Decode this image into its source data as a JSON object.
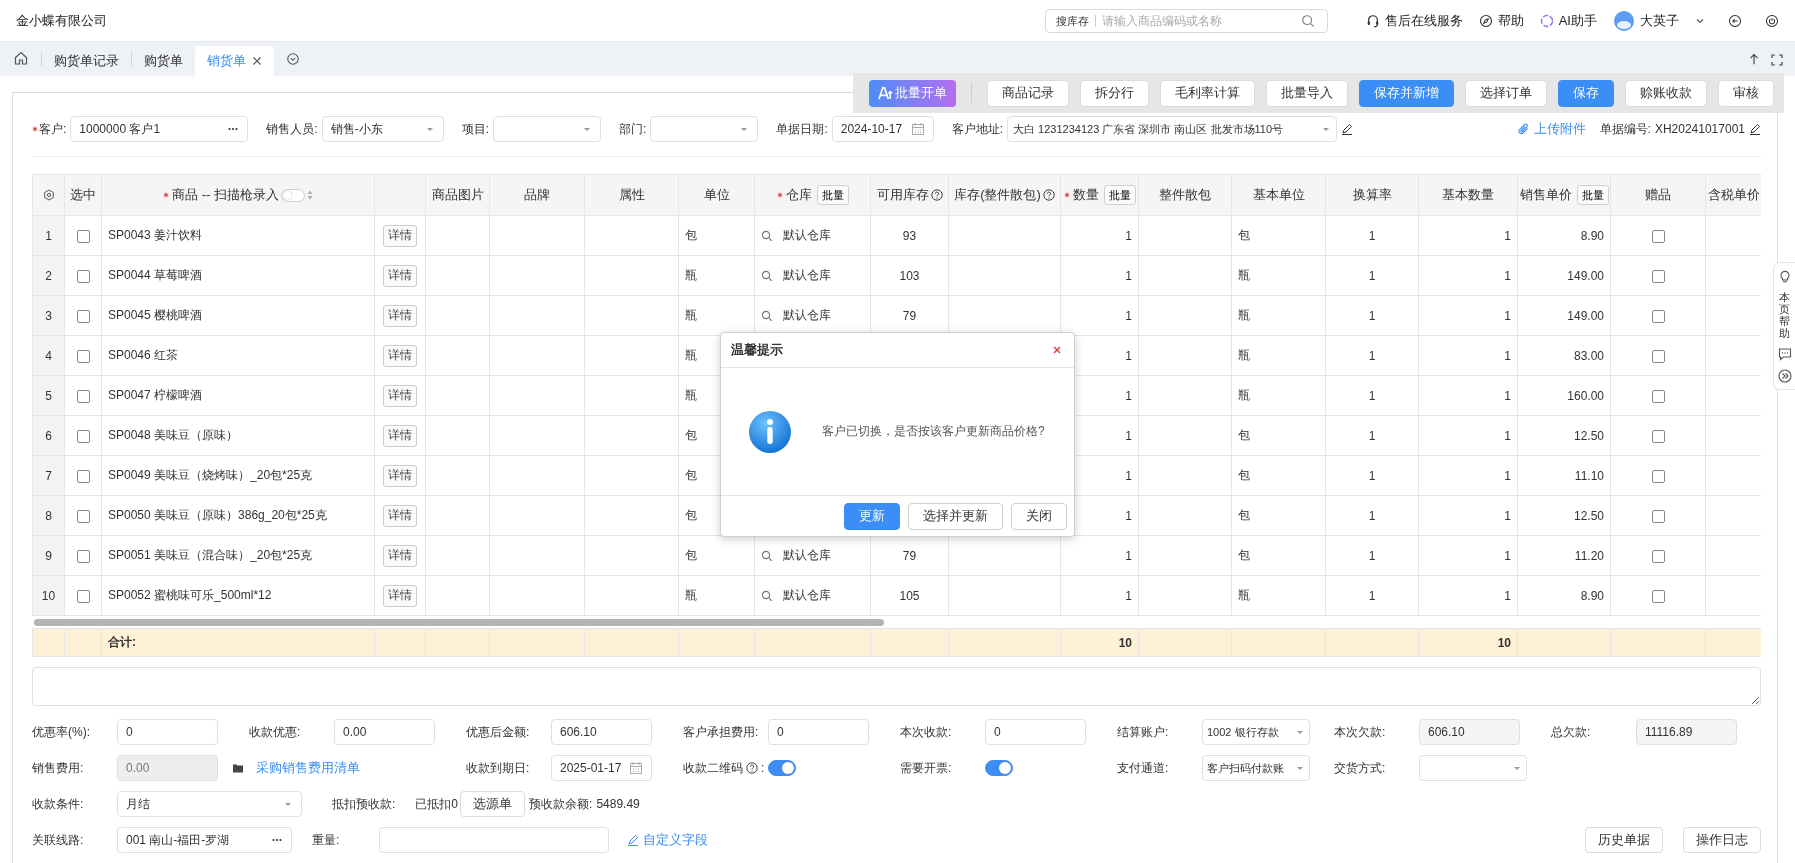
{
  "topbar": {
    "company": "金小蝶有限公司",
    "search": {
      "scope": "搜库存",
      "placeholder": "请输入商品编码或名称"
    },
    "links": [
      {
        "kind": "headset",
        "label": "售后在线服务"
      },
      {
        "kind": "compass",
        "label": "帮助"
      },
      {
        "kind": "ai",
        "label": "AI助手"
      }
    ],
    "user": "大英子"
  },
  "tabs": [
    {
      "label": "购货单记录",
      "selected": false,
      "closable": false
    },
    {
      "label": "购货单",
      "selected": false,
      "closable": false
    },
    {
      "label": "销货单",
      "selected": true,
      "closable": true
    }
  ],
  "toolbar": [
    {
      "label": "批量开单",
      "kind": "ai"
    },
    {
      "label": "商品记录",
      "kind": "default"
    },
    {
      "label": "拆分行",
      "kind": "default"
    },
    {
      "label": "毛利率计算",
      "kind": "default"
    },
    {
      "label": "批量导入",
      "kind": "default"
    },
    {
      "label": "保存并新增",
      "kind": "primary"
    },
    {
      "label": "选择订单",
      "kind": "default"
    },
    {
      "label": "保存",
      "kind": "primary"
    },
    {
      "label": "赊账收款",
      "kind": "default"
    },
    {
      "label": "审核",
      "kind": "default"
    }
  ],
  "header_form": {
    "fields": [
      {
        "label": "客户:",
        "required": true,
        "kind": "lookup",
        "value": "1000000 客户1"
      },
      {
        "label": "销售人员:",
        "required": false,
        "kind": "select",
        "value": "销售-小东"
      },
      {
        "label": "项目:",
        "required": false,
        "kind": "select"
      },
      {
        "label": "部门:",
        "required": false,
        "kind": "select"
      },
      {
        "label": "单据日期:",
        "required": false,
        "kind": "date",
        "value": "2024-10-17"
      },
      {
        "label": "客户地址:",
        "required": false,
        "kind": "select_editable",
        "value": "大白 1231234123 广东省 深圳市 南山区 批发市场110号"
      }
    ],
    "attachment": "上传附件",
    "doc_no_label": "单据编号:",
    "doc_no": "XH20241017001"
  },
  "table": {
    "columns": [
      {
        "kind": "settings"
      },
      {
        "kind": "text",
        "label": "选中"
      },
      {
        "kind": "text",
        "label": "商品 -- 扫描枪录入",
        "required": true,
        "scan_entry": false
      },
      {
        "kind": "blank"
      },
      {
        "kind": "text",
        "label": "商品图片"
      },
      {
        "kind": "text",
        "label": "品牌"
      },
      {
        "kind": "text",
        "label": "属性"
      },
      {
        "kind": "text",
        "label": "单位"
      },
      {
        "kind": "text",
        "label": "仓库",
        "required": true,
        "batch_button": "批量"
      },
      {
        "kind": "text",
        "label": "可用库存",
        "help": true
      },
      {
        "kind": "text",
        "label": "库存(整件散包)",
        "help": true
      },
      {
        "kind": "text",
        "label": "数量",
        "required": true,
        "batch_button": "批量"
      },
      {
        "kind": "text",
        "label": "整件散包"
      },
      {
        "kind": "text",
        "label": "基本单位"
      },
      {
        "kind": "text",
        "label": "换算率"
      },
      {
        "kind": "text",
        "label": "基本数量"
      },
      {
        "kind": "text",
        "label": "销售单价",
        "batch_button": "批量"
      },
      {
        "kind": "text",
        "label": "赠品"
      },
      {
        "kind": "text",
        "label": "含税单价"
      }
    ],
    "rows": [
      {
        "index": "1",
        "selected": false,
        "product": "SP0043 姜汁饮料",
        "detail": "详情",
        "unit": "包",
        "warehouse": "默认仓库",
        "available": "93",
        "qty": "1",
        "base_unit": "包",
        "rate": "1",
        "base_qty": "1",
        "price": "8.90",
        "gift": false
      },
      {
        "index": "2",
        "selected": false,
        "product": "SP0044 草莓啤酒",
        "detail": "详情",
        "unit": "瓶",
        "warehouse": "默认仓库",
        "available": "103",
        "qty": "1",
        "base_unit": "瓶",
        "rate": "1",
        "base_qty": "1",
        "price": "149.00",
        "gift": false
      },
      {
        "index": "3",
        "selected": false,
        "product": "SP0045 樱桃啤酒",
        "detail": "详情",
        "unit": "瓶",
        "warehouse": "默认仓库",
        "available": "79",
        "qty": "1",
        "base_unit": "瓶",
        "rate": "1",
        "base_qty": "1",
        "price": "149.00",
        "gift": false
      },
      {
        "index": "4",
        "selected": false,
        "product": "SP0046 红茶",
        "detail": "详情",
        "unit": "瓶",
        "qty": "1",
        "base_unit": "瓶",
        "rate": "1",
        "base_qty": "1",
        "price": "83.00",
        "gift": false
      },
      {
        "index": "5",
        "selected": false,
        "product": "SP0047 柠檬啤酒",
        "detail": "详情",
        "unit": "瓶",
        "qty": "1",
        "base_unit": "瓶",
        "rate": "1",
        "base_qty": "1",
        "price": "160.00",
        "gift": false
      },
      {
        "index": "6",
        "selected": false,
        "product": "SP0048 美味豆（原味）",
        "detail": "详情",
        "unit": "包",
        "qty": "1",
        "base_unit": "包",
        "rate": "1",
        "base_qty": "1",
        "price": "12.50",
        "gift": false
      },
      {
        "index": "7",
        "selected": false,
        "product": "SP0049 美味豆（烧烤味）_20包*25克",
        "detail": "详情",
        "unit": "包",
        "qty": "1",
        "base_unit": "包",
        "rate": "1",
        "base_qty": "1",
        "price": "11.10",
        "gift": false
      },
      {
        "index": "8",
        "selected": false,
        "product": "SP0050 美味豆（原味）386g_20包*25克",
        "detail": "详情",
        "unit": "包",
        "qty": "1",
        "base_unit": "包",
        "rate": "1",
        "base_qty": "1",
        "price": "12.50",
        "gift": false
      },
      {
        "index": "9",
        "selected": false,
        "product": "SP0051 美味豆（混合味）_20包*25克",
        "detail": "详情",
        "unit": "包",
        "warehouse": "默认仓库",
        "available": "79",
        "qty": "1",
        "base_unit": "包",
        "rate": "1",
        "base_qty": "1",
        "price": "11.20",
        "gift": false
      },
      {
        "index": "10",
        "selected": false,
        "product": "SP0052 蜜桃味可乐_500ml*12",
        "detail": "详情",
        "unit": "瓶",
        "warehouse": "默认仓库",
        "available": "105",
        "qty": "1",
        "base_unit": "瓶",
        "rate": "1",
        "base_qty": "1",
        "price": "8.90",
        "gift": false
      }
    ],
    "summary": {
      "product": "合计:",
      "qty": "10",
      "base_qty": "10"
    }
  },
  "bottom_form": {
    "row1": [
      {
        "label": "优惠率(%):",
        "kind": "input",
        "value": "0"
      },
      {
        "label": "收款优惠:",
        "kind": "input",
        "value": "0.00"
      },
      {
        "label": "优惠后金额:",
        "kind": "input",
        "value": "606.10"
      },
      {
        "label": "客户承担费用:",
        "kind": "input",
        "value": "0"
      },
      {
        "label": "本次收款:",
        "kind": "input",
        "value": "0"
      },
      {
        "label": "结算账户:",
        "kind": "select",
        "value": "1002 银行存款"
      },
      {
        "label": "本次欠款:",
        "kind": "readonly",
        "value": "606.10"
      },
      {
        "label": "总欠款:",
        "kind": "readonly",
        "value": "11116.89"
      }
    ],
    "row2": [
      {
        "label": "销售费用:",
        "kind": "disabled",
        "value": "0.00"
      },
      {
        "label": "采购销售费用清单",
        "kind": "link"
      },
      {
        "label": "收款到期日:",
        "kind": "date",
        "value": "2025-01-17"
      },
      {
        "label": "收款二维码",
        "kind": "toggle",
        "help": true,
        "suffix": ":",
        "on": true
      },
      {
        "label": "需要开票:",
        "kind": "toggle",
        "on": true
      },
      {
        "label": "支付通道:",
        "kind": "select",
        "value": "客户扫码付款账"
      },
      {
        "label": "交货方式:",
        "kind": "select"
      }
    ],
    "payment_terms": {
      "label": "收款条件:",
      "value": "月结"
    },
    "prepay": {
      "label": "抵扣预收款:",
      "deducted": "已抵扣0",
      "button": "选源单",
      "balance_label": "预收款余额:",
      "balance": "5489.49"
    },
    "route": {
      "label": "关联线路:",
      "value": "001 南山-福田-罗湖"
    },
    "weight": {
      "label": "重量:"
    },
    "custom_field_link": "自定义字段",
    "buttons": [
      "历史单据",
      "操作日志"
    ]
  },
  "dialog": {
    "title": "温馨提示",
    "message": "客户已切换，是否按该客户更新商品价格?",
    "buttons": [
      {
        "label": "更新",
        "kind": "primary"
      },
      {
        "label": "选择并更新",
        "kind": "default"
      },
      {
        "label": "关闭",
        "kind": "default"
      }
    ]
  },
  "side_help": {
    "label": "本页帮助"
  }
}
